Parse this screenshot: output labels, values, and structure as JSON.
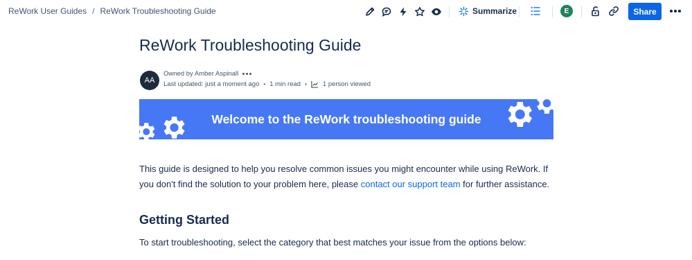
{
  "breadcrumb": {
    "items": [
      "ReWork User Guides",
      "ReWork Troubleshooting Guide"
    ],
    "separator": "/"
  },
  "toolbar": {
    "summarize_label": "Summarize",
    "share_label": "Share",
    "user_initial": "E",
    "icons": [
      "pencil-icon",
      "comment-icon",
      "lightning-icon",
      "star-icon",
      "eye-icon",
      "sparkle-icon",
      "table-of-contents-icon",
      "restrictions-icon",
      "link-icon",
      "more-icon"
    ]
  },
  "page": {
    "title": "ReWork Troubleshooting Guide",
    "byline": {
      "avatar_initials": "AA",
      "owner": "Owned by Amber Aspinall",
      "last_updated": "Last updated: just a moment ago",
      "read_time": "1 min read",
      "views": "1 person viewed"
    }
  },
  "banner": {
    "text": "Welcome to the ReWork troubleshooting guide",
    "color": "#4678f5"
  },
  "content": {
    "intro_before": "This guide is designed to help you resolve common issues you might encounter while using ReWork. If you don't find the solution to your problem here, please ",
    "intro_link": "contact our support team",
    "intro_after": " for further assistance.",
    "heading": "Getting Started",
    "instruction": "To start troubleshooting, select the category that best matches your issue from the options below:"
  },
  "colors": {
    "accent": "#0c66e4",
    "text": "#172b4d",
    "avatar_green": "#1f845a"
  }
}
